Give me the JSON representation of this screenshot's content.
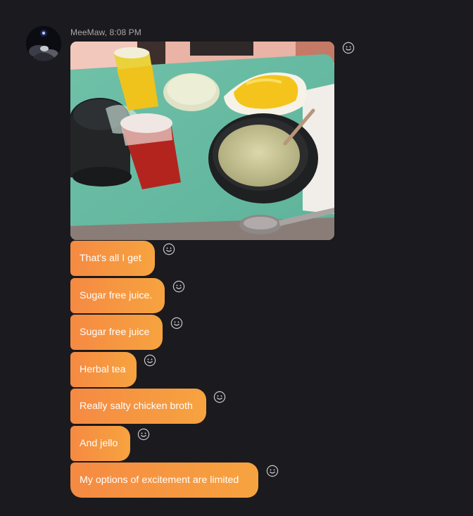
{
  "message_group": {
    "sender_line": "MeeMaw, 8:08 PM",
    "photo_alt": "Hospital tray photo",
    "messages": [
      {
        "text": "That's all I get"
      },
      {
        "text": "Sugar free juice."
      },
      {
        "text": "Sugar free juice"
      },
      {
        "text": "Herbal tea"
      },
      {
        "text": "Really salty chicken broth"
      },
      {
        "text": "And jello"
      },
      {
        "text": "My options of excitement are limited"
      }
    ]
  },
  "icons": {
    "reaction": "smiley-face-icon",
    "avatar": "user-avatar"
  },
  "colors": {
    "background": "#1b1a1e",
    "bubble_gradient_start": "#f58a42",
    "bubble_gradient_end": "#f7a340",
    "meta_text": "#a8a8ad",
    "icon": "#c9c9cc"
  }
}
